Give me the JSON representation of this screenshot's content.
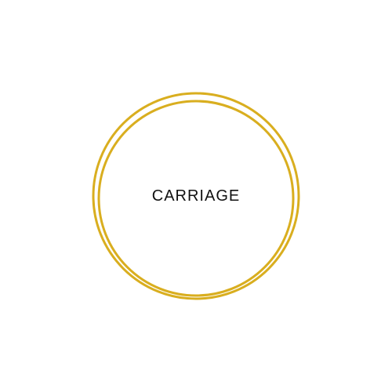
{
  "logo": {
    "brand_name": "CARRIAGE",
    "ring_color": "#D9AE1F",
    "text_color": "#111111",
    "background_color": "#FFFFFF"
  }
}
